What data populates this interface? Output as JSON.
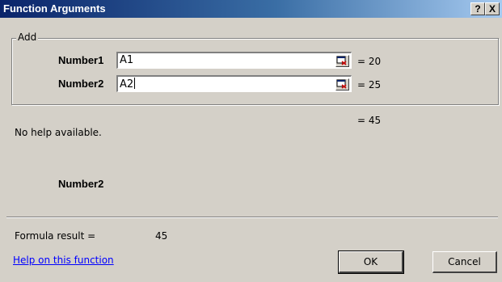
{
  "window": {
    "title": "Function Arguments",
    "help_button": "?",
    "close_button": "X"
  },
  "group": {
    "legend": "Add"
  },
  "arguments": [
    {
      "label": "Number1",
      "value": "A1",
      "result": "= 20"
    },
    {
      "label": "Number2",
      "value": "A2",
      "result": "= 25"
    }
  ],
  "function_result": "= 45",
  "description": "No help available.",
  "selected_arg_name": "Number2",
  "formula_result": {
    "label": "Formula result =",
    "value": "45"
  },
  "help_link": "Help on this function",
  "buttons": {
    "ok": "OK",
    "cancel": "Cancel"
  },
  "icons": {
    "collapse": "collapse-dialog-icon"
  }
}
